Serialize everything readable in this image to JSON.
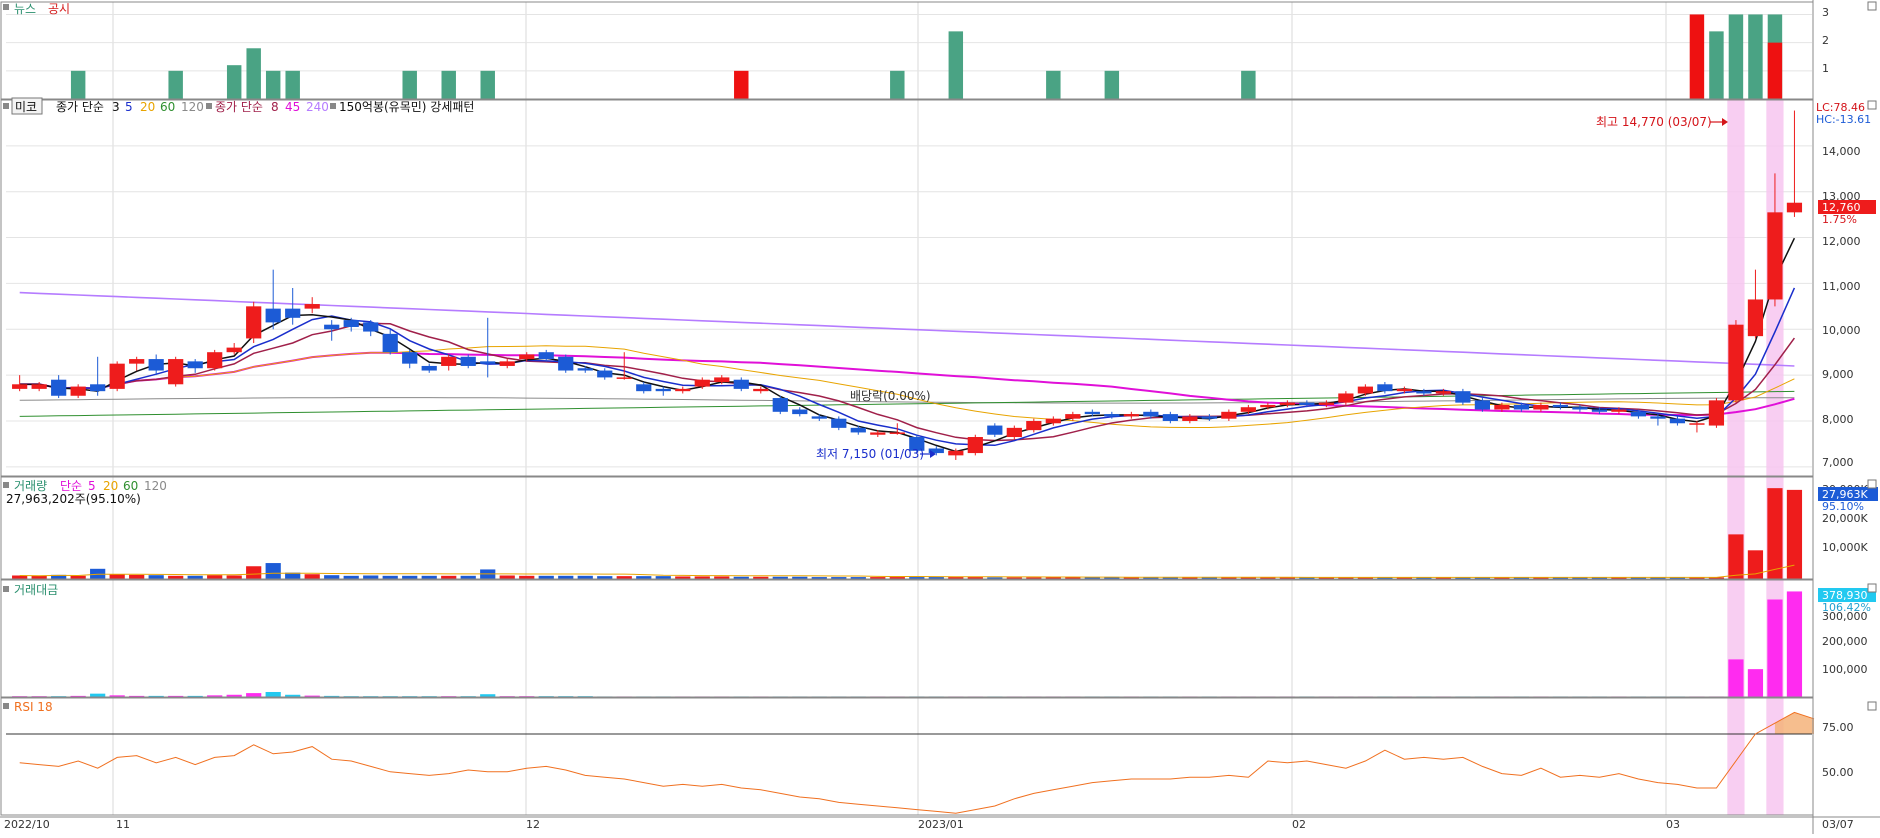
{
  "panels": {
    "news": {
      "legend": [
        "뉴스",
        "공시"
      ],
      "ticks": [
        "3",
        "2",
        "1"
      ]
    },
    "price": {
      "legend": [
        "미코",
        "종가 단순",
        "3",
        "5",
        "20",
        "60",
        "120",
        "종가 단순",
        "8",
        "45",
        "240",
        "150억봉(유목민) 강세패턴"
      ],
      "ticks": [
        "14,000",
        "13,000",
        "12,000",
        "11,000",
        "10,000",
        "9,000",
        "8,000",
        "7,000"
      ],
      "lc_label": "LC:78.46",
      "hc_label": "HC:-13.61",
      "price_badge": "12,760",
      "price_change": "1.75%",
      "high_annotation": "최고 14,770 (03/07)",
      "low_annotation": "최저 7,150 (01/03)",
      "dividend_annotation": "배당락(0.00%)"
    },
    "volume": {
      "legend": [
        "거래량",
        "단순",
        "5",
        "20",
        "60",
        "120"
      ],
      "summary": "27,963,202주(95.10%)",
      "ticks": [
        "30,000K",
        "20,000K",
        "10,000K"
      ],
      "badge": "27,963K",
      "badge_pct": "95.10%"
    },
    "amount": {
      "legend": [
        "거래대금"
      ],
      "ticks": [
        "300,000",
        "200,000",
        "100,000"
      ],
      "badge": "378,930",
      "badge_pct": "106.42%"
    },
    "rsi": {
      "legend": [
        "RSI 18"
      ],
      "ticks": [
        "75.00",
        "50.00"
      ]
    },
    "xaxis": {
      "labels": [
        "2022/10",
        "11",
        "12",
        "2023/01",
        "02",
        "03",
        "03/07"
      ]
    }
  },
  "colors": {
    "up": "#ee1c1c",
    "down": "#1c5bd6",
    "news": "#4aa384",
    "disclosure": "#ee1111",
    "ma3": "#111111",
    "ma5": "#1a2ecc",
    "ma20": "#e8a400",
    "ma60": "#2f8f2f",
    "ma120": "#8a8a8a",
    "ma8": "#a0204a",
    "ma45": "#e010d8",
    "ma240": "#b57cff",
    "rsi": "#f07020",
    "highlight": "#f7c6f0",
    "amount_up": "#ff2bf0",
    "amount_down": "#22c9f0"
  },
  "chart_data": {
    "type": "candlestick",
    "x_start": "2022/10",
    "x_end": "03/07",
    "ylim": [
      6800,
      15000
    ],
    "price_high": {
      "value": 14770,
      "date": "03/07"
    },
    "price_low": {
      "value": 7150,
      "date": "01/03"
    },
    "candles": [
      {
        "x": 1,
        "o": 8700,
        "c": 8800,
        "h": 9000,
        "l": 8650
      },
      {
        "x": 2,
        "o": 8700,
        "c": 8800,
        "h": 8850,
        "l": 8650
      },
      {
        "x": 3,
        "o": 8900,
        "c": 8550,
        "h": 9000,
        "l": 8500
      },
      {
        "x": 4,
        "o": 8550,
        "c": 8750,
        "h": 8800,
        "l": 8500
      },
      {
        "x": 5,
        "o": 8800,
        "c": 8650,
        "h": 9400,
        "l": 8550
      },
      {
        "x": 6,
        "o": 8700,
        "c": 9250,
        "h": 9300,
        "l": 8650
      },
      {
        "x": 7,
        "o": 9250,
        "c": 9350,
        "h": 9400,
        "l": 9100
      },
      {
        "x": 8,
        "o": 9350,
        "c": 9100,
        "h": 9450,
        "l": 9000
      },
      {
        "x": 9,
        "o": 8800,
        "c": 9350,
        "h": 9400,
        "l": 8750
      },
      {
        "x": 10,
        "o": 9300,
        "c": 9150,
        "h": 9350,
        "l": 9050
      },
      {
        "x": 11,
        "o": 9150,
        "c": 9500,
        "h": 9550,
        "l": 9100
      },
      {
        "x": 12,
        "o": 9500,
        "c": 9600,
        "h": 9700,
        "l": 9450
      },
      {
        "x": 13,
        "o": 9800,
        "c": 10500,
        "h": 10600,
        "l": 9700
      },
      {
        "x": 14,
        "o": 10450,
        "c": 10150,
        "h": 11300,
        "l": 10000
      },
      {
        "x": 15,
        "o": 10450,
        "c": 10250,
        "h": 10900,
        "l": 10100
      },
      {
        "x": 16,
        "o": 10450,
        "c": 10550,
        "h": 10700,
        "l": 10350
      },
      {
        "x": 17,
        "o": 10100,
        "c": 10000,
        "h": 10200,
        "l": 9750
      },
      {
        "x": 18,
        "o": 10200,
        "c": 10050,
        "h": 10250,
        "l": 9950
      },
      {
        "x": 19,
        "o": 10150,
        "c": 9950,
        "h": 10200,
        "l": 9850
      },
      {
        "x": 20,
        "o": 9900,
        "c": 9500,
        "h": 10000,
        "l": 9450
      },
      {
        "x": 21,
        "o": 9500,
        "c": 9250,
        "h": 9550,
        "l": 9150
      },
      {
        "x": 22,
        "o": 9200,
        "c": 9100,
        "h": 9250,
        "l": 9050
      },
      {
        "x": 23,
        "o": 9200,
        "c": 9400,
        "h": 9450,
        "l": 9100
      },
      {
        "x": 24,
        "o": 9400,
        "c": 9200,
        "h": 9450,
        "l": 9150
      },
      {
        "x": 25,
        "o": 9300,
        "c": 9250,
        "h": 10250,
        "l": 8950
      },
      {
        "x": 26,
        "o": 9200,
        "c": 9300,
        "h": 9350,
        "l": 9150
      },
      {
        "x": 27,
        "o": 9350,
        "c": 9450,
        "h": 9500,
        "l": 9300
      },
      {
        "x": 28,
        "o": 9500,
        "c": 9350,
        "h": 9550,
        "l": 9300
      },
      {
        "x": 29,
        "o": 9400,
        "c": 9100,
        "h": 9450,
        "l": 9050
      },
      {
        "x": 30,
        "o": 9150,
        "c": 9100,
        "h": 9200,
        "l": 9050
      },
      {
        "x": 31,
        "o": 9100,
        "c": 8950,
        "h": 9150,
        "l": 8900
      },
      {
        "x": 32,
        "o": 8950,
        "c": 8950,
        "h": 9500,
        "l": 8900
      },
      {
        "x": 33,
        "o": 8800,
        "c": 8650,
        "h": 8850,
        "l": 8600
      },
      {
        "x": 34,
        "o": 8700,
        "c": 8650,
        "h": 8750,
        "l": 8550
      },
      {
        "x": 35,
        "o": 8650,
        "c": 8700,
        "h": 8750,
        "l": 8600
      },
      {
        "x": 36,
        "o": 8750,
        "c": 8900,
        "h": 8950,
        "l": 8700
      },
      {
        "x": 37,
        "o": 8850,
        "c": 8950,
        "h": 9000,
        "l": 8800
      },
      {
        "x": 38,
        "o": 8900,
        "c": 8700,
        "h": 8950,
        "l": 8650
      },
      {
        "x": 39,
        "o": 8650,
        "c": 8700,
        "h": 8750,
        "l": 8600
      },
      {
        "x": 40,
        "o": 8500,
        "c": 8200,
        "h": 8550,
        "l": 8150
      },
      {
        "x": 41,
        "o": 8250,
        "c": 8150,
        "h": 8300,
        "l": 8100
      },
      {
        "x": 42,
        "o": 8100,
        "c": 8050,
        "h": 8150,
        "l": 8000
      },
      {
        "x": 43,
        "o": 8050,
        "c": 7850,
        "h": 8100,
        "l": 7800
      },
      {
        "x": 44,
        "o": 7850,
        "c": 7750,
        "h": 7900,
        "l": 7700
      },
      {
        "x": 45,
        "o": 7700,
        "c": 7750,
        "h": 7800,
        "l": 7650
      },
      {
        "x": 46,
        "o": 7750,
        "c": 7750,
        "h": 7950,
        "l": 7700
      },
      {
        "x": 47,
        "o": 7650,
        "c": 7350,
        "h": 7700,
        "l": 7300
      },
      {
        "x": 48,
        "o": 7400,
        "c": 7300,
        "h": 7450,
        "l": 7250
      },
      {
        "x": 49,
        "o": 7250,
        "c": 7350,
        "h": 7400,
        "l": 7150
      },
      {
        "x": 50,
        "o": 7300,
        "c": 7650,
        "h": 7700,
        "l": 7250
      },
      {
        "x": 51,
        "o": 7900,
        "c": 7700,
        "h": 7950,
        "l": 7650
      },
      {
        "x": 52,
        "o": 7650,
        "c": 7850,
        "h": 7900,
        "l": 7600
      },
      {
        "x": 53,
        "o": 7800,
        "c": 8000,
        "h": 8050,
        "l": 7750
      },
      {
        "x": 54,
        "o": 7950,
        "c": 8050,
        "h": 8100,
        "l": 7900
      },
      {
        "x": 55,
        "o": 8050,
        "c": 8150,
        "h": 8200,
        "l": 8000
      },
      {
        "x": 56,
        "o": 8200,
        "c": 8150,
        "h": 8250,
        "l": 8100
      },
      {
        "x": 57,
        "o": 8150,
        "c": 8100,
        "h": 8200,
        "l": 8050
      },
      {
        "x": 58,
        "o": 8100,
        "c": 8150,
        "h": 8200,
        "l": 8050
      },
      {
        "x": 59,
        "o": 8200,
        "c": 8100,
        "h": 8250,
        "l": 8050
      },
      {
        "x": 60,
        "o": 8150,
        "c": 8000,
        "h": 8200,
        "l": 7950
      },
      {
        "x": 61,
        "o": 8000,
        "c": 8100,
        "h": 8150,
        "l": 7950
      },
      {
        "x": 62,
        "o": 8100,
        "c": 8050,
        "h": 8150,
        "l": 8000
      },
      {
        "x": 63,
        "o": 8050,
        "c": 8200,
        "h": 8250,
        "l": 8000
      },
      {
        "x": 64,
        "o": 8200,
        "c": 8300,
        "h": 8350,
        "l": 8150
      },
      {
        "x": 65,
        "o": 8300,
        "c": 8350,
        "h": 8400,
        "l": 8250
      },
      {
        "x": 66,
        "o": 8350,
        "c": 8400,
        "h": 8450,
        "l": 8300
      },
      {
        "x": 67,
        "o": 8400,
        "c": 8350,
        "h": 8450,
        "l": 8300
      },
      {
        "x": 68,
        "o": 8350,
        "c": 8400,
        "h": 8450,
        "l": 8300
      },
      {
        "x": 69,
        "o": 8400,
        "c": 8600,
        "h": 8650,
        "l": 8350
      },
      {
        "x": 70,
        "o": 8600,
        "c": 8750,
        "h": 8800,
        "l": 8550
      },
      {
        "x": 71,
        "o": 8800,
        "c": 8650,
        "h": 8850,
        "l": 8600
      },
      {
        "x": 72,
        "o": 8650,
        "c": 8700,
        "h": 8750,
        "l": 8600
      },
      {
        "x": 73,
        "o": 8650,
        "c": 8600,
        "h": 8700,
        "l": 8550
      },
      {
        "x": 74,
        "o": 8600,
        "c": 8650,
        "h": 8700,
        "l": 8550
      },
      {
        "x": 75,
        "o": 8650,
        "c": 8400,
        "h": 8700,
        "l": 8350
      },
      {
        "x": 76,
        "o": 8450,
        "c": 8250,
        "h": 8500,
        "l": 8200
      },
      {
        "x": 77,
        "o": 8250,
        "c": 8350,
        "h": 8400,
        "l": 8200
      },
      {
        "x": 78,
        "o": 8350,
        "c": 8250,
        "h": 8400,
        "l": 8200
      },
      {
        "x": 79,
        "o": 8250,
        "c": 8350,
        "h": 8400,
        "l": 8200
      },
      {
        "x": 80,
        "o": 8350,
        "c": 8300,
        "h": 8400,
        "l": 8250
      },
      {
        "x": 81,
        "o": 8300,
        "c": 8250,
        "h": 8350,
        "l": 8200
      },
      {
        "x": 82,
        "o": 8250,
        "c": 8200,
        "h": 8300,
        "l": 8150
      },
      {
        "x": 83,
        "o": 8200,
        "c": 8250,
        "h": 8300,
        "l": 8150
      },
      {
        "x": 84,
        "o": 8200,
        "c": 8100,
        "h": 8250,
        "l": 8050
      },
      {
        "x": 85,
        "o": 8100,
        "c": 8050,
        "h": 8150,
        "l": 7900
      },
      {
        "x": 86,
        "o": 8050,
        "c": 7950,
        "h": 8100,
        "l": 7900
      },
      {
        "x": 87,
        "o": 7950,
        "c": 7950,
        "h": 8000,
        "l": 7750
      },
      {
        "x": 88,
        "o": 7900,
        "c": 8450,
        "h": 8500,
        "l": 7850
      },
      {
        "x": 89,
        "o": 8450,
        "c": 10100,
        "h": 10200,
        "l": 8400
      },
      {
        "x": 90,
        "o": 9850,
        "c": 10650,
        "h": 11300,
        "l": 9800
      },
      {
        "x": 91,
        "o": 10650,
        "c": 12550,
        "h": 13400,
        "l": 10500
      },
      {
        "x": 92,
        "o": 12550,
        "c": 12760,
        "h": 14770,
        "l": 12450
      }
    ],
    "news_series": [
      {
        "name": "뉴스",
        "x": [
          4,
          9,
          12,
          13,
          14,
          15,
          21,
          23,
          25,
          46,
          49,
          54,
          57,
          64,
          88,
          89,
          90,
          91
        ],
        "values": [
          1,
          1,
          1.2,
          1.8,
          1,
          1,
          1,
          1,
          1,
          1,
          2.4,
          1,
          1,
          1,
          2.4,
          3,
          3,
          3
        ]
      },
      {
        "name": "공시",
        "x": [
          38,
          87,
          91
        ],
        "values": [
          1,
          3,
          2
        ]
      }
    ],
    "volume": [
      1.1,
      1,
      1.3,
      1,
      3.2,
      1.5,
      1.3,
      1.2,
      1,
      1,
      1.2,
      1.1,
      4,
      5,
      2,
      1.5,
      1.2,
      1,
      1.1,
      1,
      1,
      1,
      1,
      1,
      3,
      1.1,
      1,
      1,
      1,
      1,
      0.9,
      0.9,
      0.9,
      0.9,
      0.8,
      0.8,
      0.8,
      0.7,
      0.7,
      0.7,
      0.7,
      0.6,
      0.6,
      0.6,
      0.6,
      0.6,
      0.6,
      0.6,
      0.6,
      0.6,
      0.5,
      0.5,
      0.5,
      0.5,
      0.5,
      0.5,
      0.5,
      0.5,
      0.5,
      0.5,
      0.5,
      0.5,
      0.5,
      0.5,
      0.5,
      0.5,
      0.5,
      0.5,
      0.5,
      0.5,
      0.5,
      0.5,
      0.5,
      0.5,
      0.5,
      0.5,
      0.5,
      0.5,
      0.5,
      0.5,
      0.5,
      0.5,
      0.5,
      0.5,
      0.5,
      0.5,
      0.5,
      0.5,
      14,
      9,
      28.5,
      27.96
    ],
    "amount": [
      3,
      3,
      3,
      4,
      12,
      6,
      4,
      4,
      4,
      4,
      6,
      8,
      14,
      18,
      8,
      5,
      4,
      3,
      3,
      3,
      3,
      3,
      3,
      3,
      10,
      3,
      3,
      3,
      3,
      3,
      2,
      2,
      2,
      2,
      2,
      2,
      2,
      2,
      2,
      2,
      2,
      2,
      2,
      2,
      2,
      2,
      2,
      2,
      2,
      2,
      2,
      2,
      2,
      2,
      2,
      2,
      2,
      2,
      2,
      2,
      2,
      2,
      2,
      2,
      2,
      2,
      2,
      2,
      2,
      2,
      2,
      2,
      2,
      2,
      2,
      2,
      2,
      2,
      2,
      2,
      2,
      2,
      2,
      2,
      2,
      2,
      2,
      2,
      135,
      100,
      350,
      378.93
    ],
    "rsi": [
      54,
      53,
      52,
      55,
      51,
      57,
      58,
      54,
      57,
      53,
      57,
      58,
      64,
      59,
      60,
      63,
      56,
      55,
      52,
      49,
      48,
      47,
      48,
      50,
      49,
      49,
      51,
      52,
      50,
      47,
      46,
      45,
      43,
      41,
      42,
      41,
      42,
      40,
      39,
      37,
      35,
      34,
      32,
      31,
      30,
      29,
      28,
      27,
      26,
      28,
      30,
      34,
      37,
      39,
      41,
      43,
      44,
      45,
      45,
      45,
      46,
      46,
      47,
      46,
      55,
      54,
      55,
      53,
      51,
      55,
      61,
      56,
      57,
      56,
      57,
      52,
      48,
      47,
      51,
      46,
      47,
      46,
      48,
      45,
      43,
      42,
      40,
      40,
      55,
      70,
      76,
      82,
      78.46
    ],
    "rsi_ylim": [
      25,
      90
    ],
    "rsi_level": 70
  }
}
